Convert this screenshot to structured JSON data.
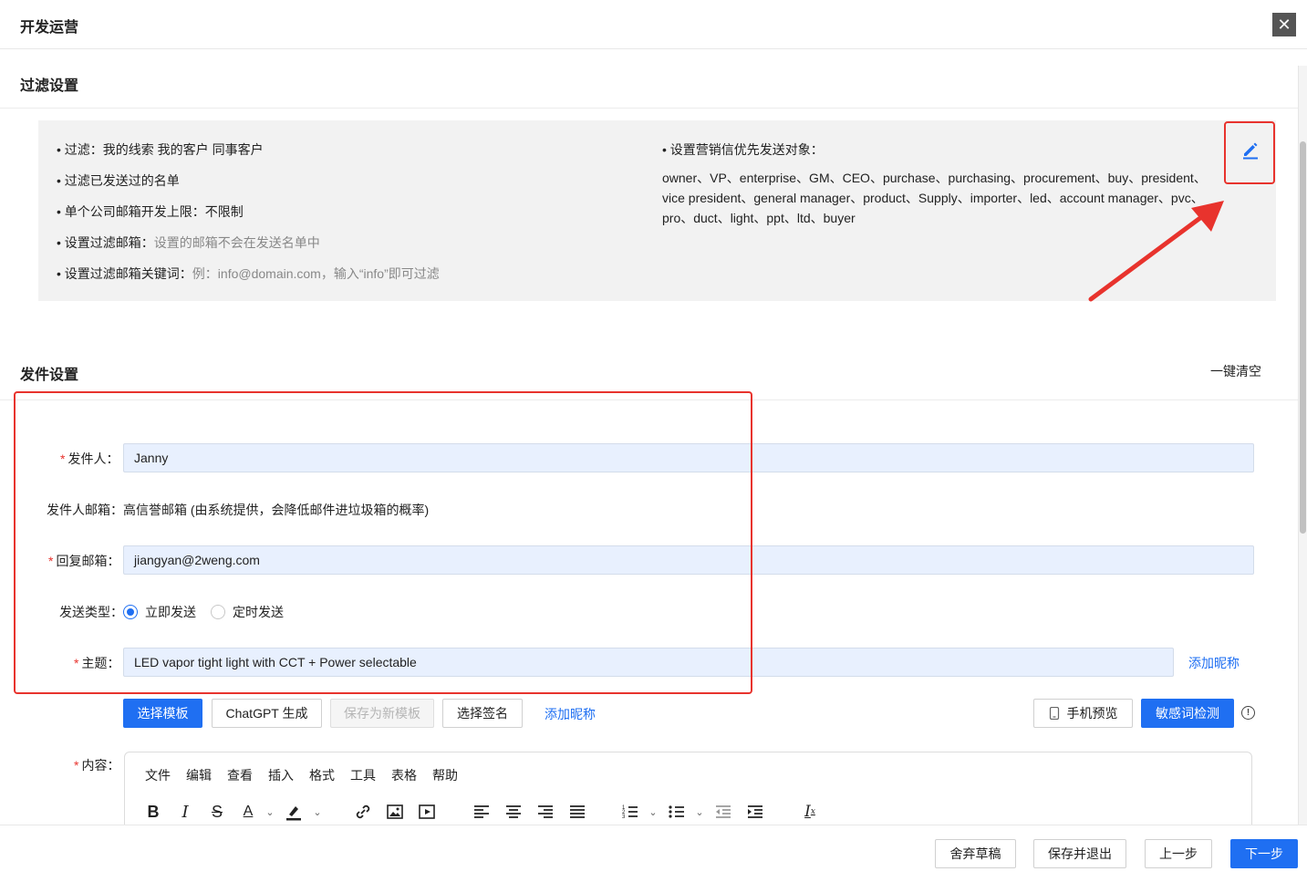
{
  "header": {
    "title": "开发运营",
    "close_glyph": "✕"
  },
  "filter_section": {
    "title": "过滤设置",
    "items": [
      {
        "label": "过滤：我的线索  我的客户  同事客户",
        "muted": ""
      },
      {
        "label": "过滤已发送过的名单",
        "muted": ""
      },
      {
        "label": "单个公司邮箱开发上限：不限制",
        "muted": ""
      },
      {
        "label": "设置过滤邮箱：",
        "muted": "设置的邮箱不会在发送名单中"
      },
      {
        "label": "设置过滤邮箱关键词：",
        "muted": "例：info@domain.com，输入“info”即可过滤"
      }
    ],
    "priority_title": "设置营销信优先发送对象：",
    "priority_text": "owner、VP、enterprise、GM、CEO、purchase、purchasing、procurement、buy、president、vice president、general manager、product、Supply、importer、led、account manager、pvc、pro、duct、light、ppt、ltd、buyer"
  },
  "send_section": {
    "title": "发件设置",
    "clear_label": "一键清空",
    "sender_label": "发件人",
    "sender_value": "Janny",
    "sender_email_label": "发件人邮箱",
    "sender_email_value": "高信誉邮箱 (由系统提供，会降低邮件进垃圾箱的概率)",
    "reply_label": "回复邮箱",
    "reply_value": "jiangyan@2weng.com",
    "send_type_label": "发送类型",
    "send_type_options": [
      {
        "label": "立即发送",
        "checked": true
      },
      {
        "label": "定时发送",
        "checked": false
      }
    ],
    "subject_label": "主题",
    "subject_value": "LED vapor tight light with CCT + Power selectable",
    "add_nickname_label": "添加昵称"
  },
  "toolbar": {
    "select_template": "选择模板",
    "chatgpt_generate": "ChatGPT 生成",
    "save_as_template": "保存为新模板",
    "select_signature": "选择签名",
    "add_nickname": "添加昵称",
    "mobile_preview": "手机预览",
    "sensitive_check": "敏感词检测"
  },
  "content": {
    "label": "内容",
    "menu": [
      "文件",
      "编辑",
      "查看",
      "插入",
      "格式",
      "工具",
      "表格",
      "帮助"
    ]
  },
  "footer": {
    "discard_draft": "舍弃草稿",
    "save_exit": "保存并退出",
    "prev_step": "上一步",
    "next_step": "下一步"
  },
  "colors": {
    "accent": "#1f6ff2",
    "highlight": "#e8332d"
  }
}
